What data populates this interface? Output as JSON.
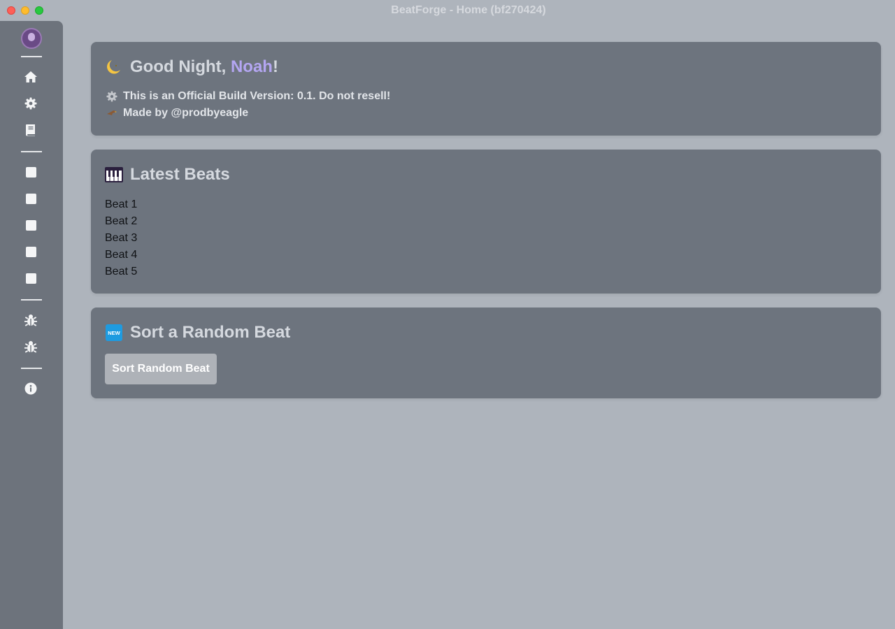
{
  "window": {
    "title": "BeatForge - Home (bf270424)"
  },
  "sidebar": {
    "top_icons": [
      "home-icon",
      "gear-icon",
      "book-icon"
    ],
    "beat_squares": [
      "square-1",
      "square-2",
      "square-3",
      "square-4",
      "square-5"
    ],
    "debug_icons": [
      "bug-icon",
      "bug-icon"
    ],
    "info_icon": "info-icon"
  },
  "welcome": {
    "greeting": "Good Night, ",
    "name": "Noah",
    "exclaim": "!",
    "build_line": "This is an Official Build Version: 0.1. Do not resell!",
    "made_by": "Made by @prodbyeagle"
  },
  "latest": {
    "title": "Latest Beats",
    "beats": [
      "Beat 1",
      "Beat 2",
      "Beat 3",
      "Beat 4",
      "Beat 5"
    ]
  },
  "random": {
    "title": "Sort a Random Beat",
    "button_label": "Sort Random Beat"
  },
  "colors": {
    "background": "#aeb4bc",
    "card": "#6d747e",
    "accent": "#b4a6f2",
    "sidebar": "#6d737c"
  }
}
